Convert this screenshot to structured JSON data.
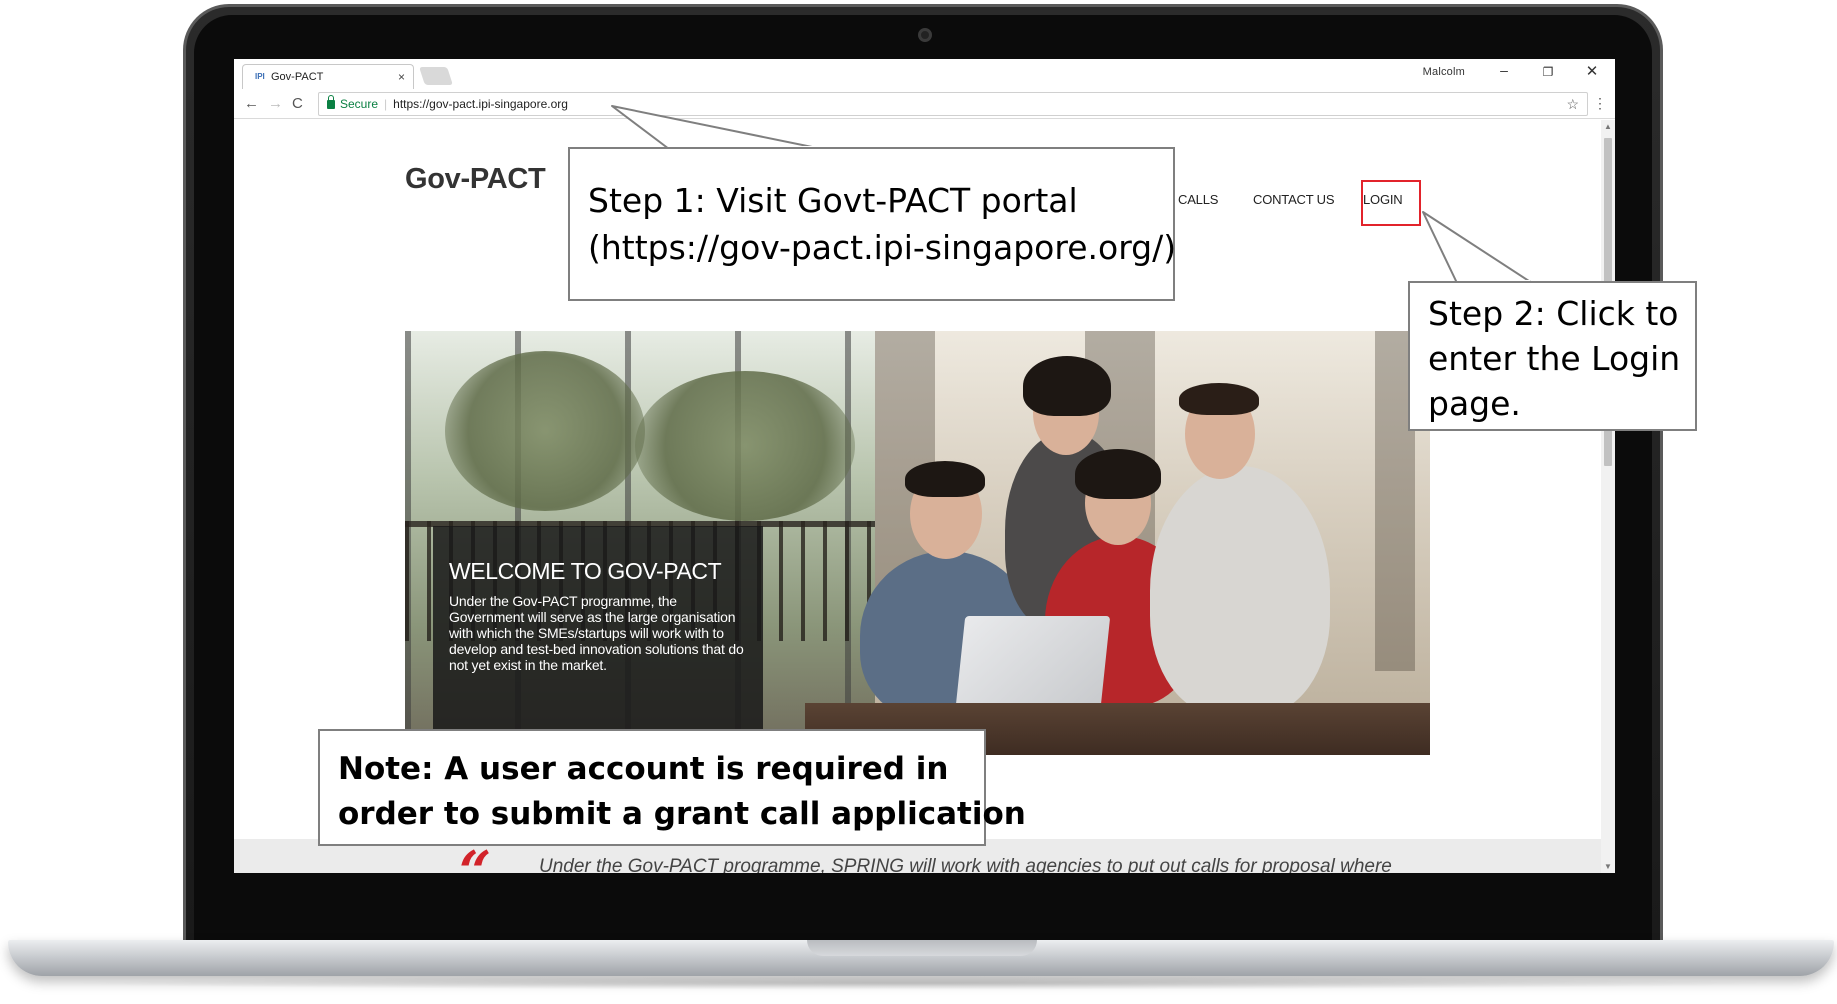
{
  "browser": {
    "tab_title": "Gov-PACT",
    "tab_favicon": "IPI",
    "tab_close": "×",
    "profile_name": "Malcolm",
    "window_min": "–",
    "window_max": "❐",
    "window_close": "✕",
    "nav_back": "←",
    "nav_forward": "→",
    "nav_reload": "C",
    "secure_label": "Secure",
    "url": "https://gov-pact.ipi-singapore.org",
    "star": "☆",
    "menu": "⋮"
  },
  "site": {
    "logo": "Gov-PACT",
    "nav": {
      "calls": "CALLS",
      "contact_us": "CONTACT US",
      "login": "LOGIN"
    },
    "hero": {
      "welcome_title": "WELCOME TO GOV-PACT",
      "welcome_text": "Under the Gov-PACT programme, the Government will serve as the large organisation with which the SMEs/startups will work with to develop and test-bed innovation solutions that do not yet exist in the market."
    },
    "carousel": {
      "slides": 2,
      "active_index": 1
    },
    "quote_mark": "“",
    "quote_text": "Under the Gov-PACT programme, SPRING will work with agencies to put out calls for proposal where"
  },
  "callouts": {
    "step1_line1": "Step 1: Visit Govt-PACT portal",
    "step1_line2": "(https://gov-pact.ipi-singapore.org/)",
    "step2_line1": "Step 2: Click to",
    "step2_line2": "enter the Login",
    "step2_line3": "page.",
    "note_line1": "Note: A user account is required in",
    "note_line2": "order to submit a grant call application"
  },
  "colors": {
    "highlight": "#e2232b",
    "secure_green": "#0b8043",
    "quote_red": "#d2232a",
    "callout_border": "#7f7f7f"
  },
  "icons": [
    "lock-icon",
    "star-icon",
    "menu-icon",
    "back-arrow-icon",
    "forward-arrow-icon",
    "reload-icon",
    "close-icon",
    "camera-icon"
  ]
}
